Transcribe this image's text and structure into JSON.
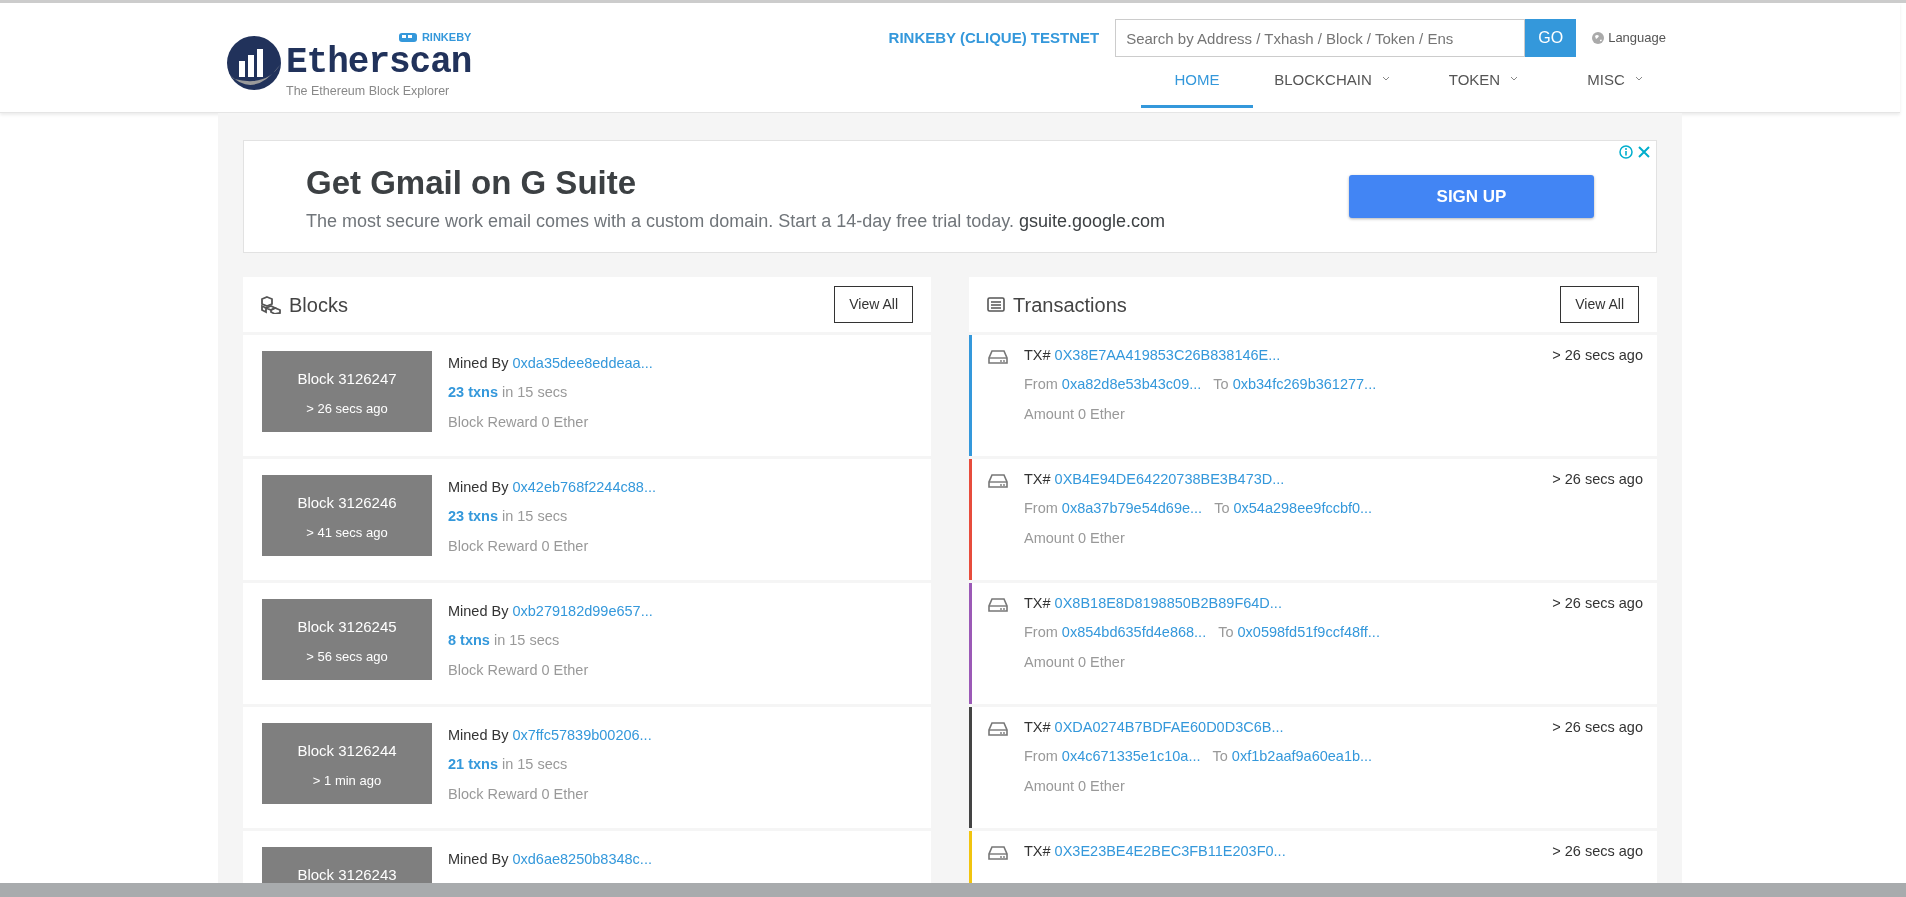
{
  "header": {
    "logo": {
      "name": "Etherscan",
      "tagline": "The Ethereum Block Explorer",
      "badge": "RINKEBY"
    },
    "network": "RINKEBY (CLIQUE) TESTNET",
    "search": {
      "placeholder": "Search by Address / Txhash / Block / Token / Ens",
      "button": "GO"
    },
    "language": "Language",
    "nav": [
      {
        "label": "HOME",
        "selected": true,
        "caret": false
      },
      {
        "label": "BLOCKCHAIN",
        "selected": false,
        "caret": true
      },
      {
        "label": "TOKEN",
        "selected": false,
        "caret": true
      },
      {
        "label": "MISC",
        "selected": false,
        "caret": true
      }
    ]
  },
  "ad": {
    "title": "Get Gmail on G Suite",
    "text": "The most secure work email comes with a custom domain. Start a 14-day free trial today.",
    "domain": "gsuite.google.com",
    "button": "SIGN UP"
  },
  "blocks": {
    "title": "Blocks",
    "view_all": "View All",
    "items": [
      {
        "block": "Block 3126247",
        "age": "> 26 secs ago",
        "miner_label": "Mined By",
        "miner": "0xda35dee8eddeaa...",
        "txns": "23 txns",
        "duration": "in 15 secs",
        "reward": "Block Reward 0 Ether"
      },
      {
        "block": "Block 3126246",
        "age": "> 41 secs ago",
        "miner_label": "Mined By",
        "miner": "0x42eb768f2244c88...",
        "txns": "23 txns",
        "duration": "in 15 secs",
        "reward": "Block Reward 0 Ether"
      },
      {
        "block": "Block 3126245",
        "age": "> 56 secs ago",
        "miner_label": "Mined By",
        "miner": "0xb279182d99e657...",
        "txns": "8 txns",
        "duration": "in 15 secs",
        "reward": "Block Reward 0 Ether"
      },
      {
        "block": "Block 3126244",
        "age": "> 1 min ago",
        "miner_label": "Mined By",
        "miner": "0x7ffc57839b00206...",
        "txns": "21 txns",
        "duration": "in 15 secs",
        "reward": "Block Reward 0 Ether"
      },
      {
        "block": "Block 3126243",
        "miner_label": "Mined By",
        "miner": "0xd6ae8250b8348c..."
      }
    ]
  },
  "transactions": {
    "title": "Transactions",
    "view_all": "View All",
    "items": [
      {
        "color": "#3498db",
        "hash_label": "TX#",
        "hash": "0X38E7AA419853C26B838146E...",
        "age": "> 26 secs ago",
        "from_label": "From",
        "from": "0xa82d8e53b43c09...",
        "to_label": "To",
        "to": "0xb34fc269b361277...",
        "amount": "Amount 0 Ether"
      },
      {
        "color": "#e74c3c",
        "hash_label": "TX#",
        "hash": "0XB4E94DE64220738BE3B473D...",
        "age": "> 26 secs ago",
        "from_label": "From",
        "from": "0x8a37b79e54d69e...",
        "to_label": "To",
        "to": "0x54a298ee9fccbf0...",
        "amount": "Amount 0 Ether"
      },
      {
        "color": "#9b59b6",
        "hash_label": "TX#",
        "hash": "0X8B18E8D8198850B2B89F64D...",
        "age": "> 26 secs ago",
        "from_label": "From",
        "from": "0x854bd635fd4e868...",
        "to_label": "To",
        "to": "0x0598fd51f9ccf48ff...",
        "amount": "Amount 0 Ether"
      },
      {
        "color": "#444444",
        "hash_label": "TX#",
        "hash": "0XDA0274B7BDFAE60D0D3C6B...",
        "age": "> 26 secs ago",
        "from_label": "From",
        "from": "0x4c671335e1c10a...",
        "to_label": "To",
        "to": "0xf1b2aaf9a60ea1b...",
        "amount": "Amount 0 Ether"
      },
      {
        "color": "#f1c40f",
        "hash_label": "TX#",
        "hash": "0X3E23BE4E2BEC3FB11E203F0...",
        "age": "> 26 secs ago"
      }
    ]
  }
}
